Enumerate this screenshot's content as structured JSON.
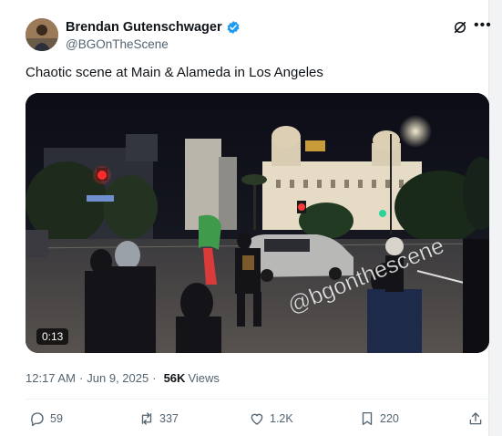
{
  "author": {
    "name": "Brendan Gutenschwager",
    "handle": "@BGOnTheScene",
    "verified": true
  },
  "tweet": {
    "text": "Chaotic scene at Main & Alameda in Los Angeles"
  },
  "media": {
    "duration": "0:13",
    "watermark": "@bgonthescene"
  },
  "meta": {
    "time": "12:17 AM",
    "separator": "·",
    "date": "Jun 9, 2025",
    "views_count": "56K",
    "views_label": "Views"
  },
  "actions": {
    "replies": "59",
    "reposts": "337",
    "likes": "1.2K",
    "bookmarks": "220"
  },
  "colors": {
    "text_primary": "#0f1419",
    "text_secondary": "#536471",
    "verified_blue": "#1d9bf0"
  }
}
